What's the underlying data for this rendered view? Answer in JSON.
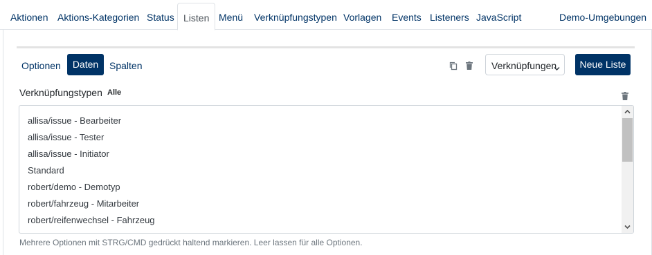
{
  "nav": {
    "tabs": [
      {
        "label": "Aktionen"
      },
      {
        "label": "Aktions-Kategorien"
      },
      {
        "label": "Status"
      },
      {
        "label": "Listen"
      },
      {
        "label": "Menü"
      },
      {
        "label": "Verknüpfungstypen"
      },
      {
        "label": "Vorlagen"
      },
      {
        "label": "Events"
      },
      {
        "label": "Listeners"
      },
      {
        "label": "JavaScript"
      }
    ],
    "active_tab": "Listen",
    "right_link": "Demo-Umgebungen"
  },
  "subtabs": [
    {
      "label": "Optionen"
    },
    {
      "label": "Daten"
    },
    {
      "label": "Spalten"
    }
  ],
  "active_subtab": "Daten",
  "toolbar": {
    "copy_icon": "copy-icon",
    "delete_icon": "trash-icon",
    "select_value": "Verknüpfungen",
    "new_button": "Neue Liste"
  },
  "field": {
    "label": "Verknüpfungstypen",
    "badge": "Alle",
    "clear_icon": "trash-icon",
    "options": [
      "allisa/issue - Bearbeiter",
      "allisa/issue - Tester",
      "allisa/issue - Initiator",
      "Standard",
      "robert/demo - Demotyp",
      "robert/fahrzeug - Mitarbeiter",
      "robert/reifenwechsel - Fahrzeug"
    ],
    "help": "Mehrere Optionen mit STRG/CMD gedrückt haltend markieren. Leer lassen für alle Optionen."
  },
  "colors": {
    "primary": "#003366",
    "link": "#003366",
    "muted": "#6c757d"
  }
}
